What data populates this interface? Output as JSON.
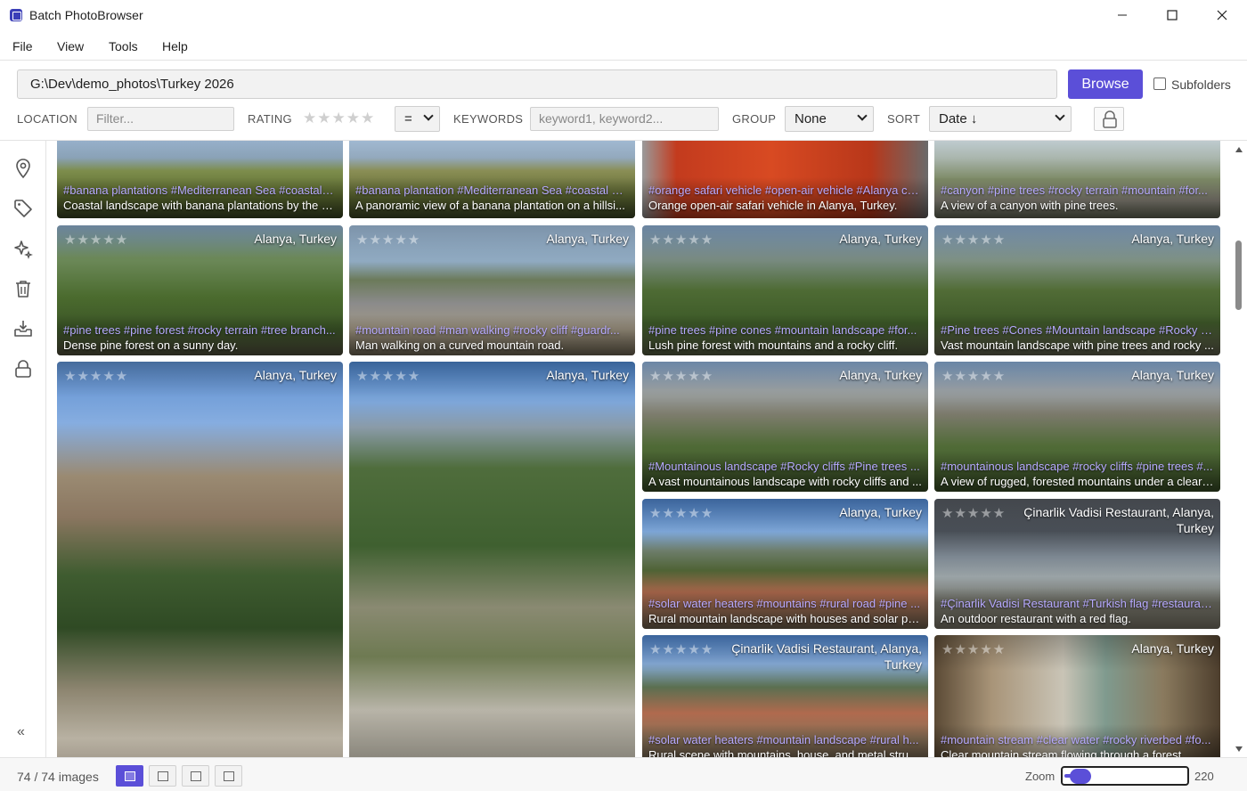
{
  "window": {
    "title": "Batch PhotoBrowser"
  },
  "menu": [
    "File",
    "View",
    "Tools",
    "Help"
  ],
  "path": {
    "value": "G:\\Dev\\demo_photos\\Turkey 2026"
  },
  "browse_label": "Browse",
  "subfolders": {
    "label": "Subfolders",
    "checked": false
  },
  "filters": {
    "location_label": "LOCATION",
    "location_placeholder": "Filter...",
    "rating_label": "RATING",
    "rating_stars": "★★★★★",
    "rating_op": "=",
    "keywords_label": "KEYWORDS",
    "keywords_placeholder": "keyword1, keyword2...",
    "group_label": "GROUP",
    "group_value": "None",
    "sort_label": "SORT",
    "sort_value": "Date ↓"
  },
  "sidebar": [
    "location-pin-icon",
    "tag-icon",
    "sparkle-icon",
    "trash-icon",
    "import-icon",
    "lock-icon"
  ],
  "sidebar_collapse": "«",
  "photos": [
    {
      "stars": "★★★★★",
      "location": "",
      "tags": "#banana plantations #Mediterranean Sea #coastal r...",
      "caption": "Coastal landscape with banana plantations by the sea"
    },
    {
      "stars": "★★★★★",
      "location": "",
      "tags": "#banana plantation #Mediterranean Sea #coastal hi...",
      "caption": "A panoramic view of a banana plantation on a hillsi..."
    },
    {
      "stars": "★★★★★",
      "location": "",
      "tags": "#orange safari vehicle #open-air vehicle #Alanya co...",
      "caption": "Orange open-air safari vehicle in Alanya, Turkey."
    },
    {
      "stars": "★★★★★",
      "location": "",
      "tags": "#canyon #pine trees #rocky terrain #mountain #for...",
      "caption": "A view of a canyon with pine trees."
    },
    {
      "stars": "★★★★★",
      "location": "Alanya, Turkey",
      "tags": "#pine trees #pine forest #rocky terrain #tree branch...",
      "caption": "Dense pine forest on a sunny day."
    },
    {
      "stars": "★★★★★",
      "location": "Alanya, Turkey",
      "tags": "#mountain road #man walking #rocky cliff #guardr...",
      "caption": "Man walking on a curved mountain road."
    },
    {
      "stars": "★★★★★",
      "location": "Alanya, Turkey",
      "tags": "#pine trees #pine cones #mountain landscape #for...",
      "caption": "Lush pine forest with mountains and a rocky cliff."
    },
    {
      "stars": "★★★★★",
      "location": "Alanya, Turkey",
      "tags": "#Pine trees #Cones #Mountain landscape #Rocky cl...",
      "caption": "Vast mountain landscape with pine trees and rocky ..."
    },
    {
      "stars": "★★★★★",
      "location": "Alanya, Turkey",
      "tags": "",
      "caption": ""
    },
    {
      "stars": "★★★★★",
      "location": "Alanya, Turkey",
      "tags": "",
      "caption": ""
    },
    {
      "stars": "★★★★★",
      "location": "Alanya, Turkey",
      "tags": "#Mountainous landscape #Rocky cliffs #Pine trees ...",
      "caption": "A vast mountainous landscape with rocky cliffs and ..."
    },
    {
      "stars": "★★★★★",
      "location": "Alanya, Turkey",
      "tags": "#mountainous landscape #rocky cliffs #pine trees #...",
      "caption": "A view of rugged, forested mountains under a clear ..."
    },
    {
      "stars": "★★★★★",
      "location": "Alanya, Turkey",
      "tags": "#solar water heaters #mountains #rural road #pine ...",
      "caption": "Rural mountain landscape with houses and solar pa..."
    },
    {
      "stars": "★★★★★",
      "location": "Çinarlik Vadisi Restaurant, Alanya, Turkey",
      "tags": "#Çinarlik Vadisi Restaurant #Turkish flag #restauran...",
      "caption": "An outdoor restaurant with a red flag."
    },
    {
      "stars": "★★★★★",
      "location": "Çinarlik Vadisi Restaurant, Alanya, Turkey",
      "tags": "#solar water heaters #mountain landscape #rural h...",
      "caption": "Rural scene with mountains, house, and metal struc..."
    },
    {
      "stars": "★★★★★",
      "location": "Alanya, Turkey",
      "tags": "#mountain stream #clear water #rocky riverbed #fo...",
      "caption": "Clear mountain stream flowing through a forest."
    }
  ],
  "status": {
    "count": "74 / 74 images",
    "zoom_label": "Zoom",
    "zoom_value": "220",
    "zoom_fraction": 0.1
  }
}
